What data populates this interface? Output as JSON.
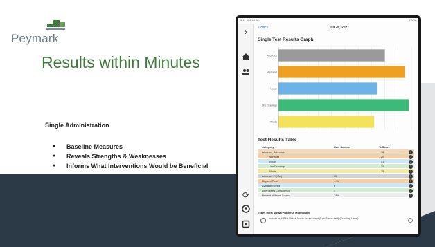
{
  "slide": {
    "logo_text": "Peymark",
    "title": "Results within Minutes",
    "subtitle": "Single Administration",
    "bullets": [
      "Baseline Measures",
      "Reveals Strengths & Weaknesses",
      "Informs What Interventions Would be Beneficial"
    ]
  },
  "colors": {
    "title_green": "#3e7a3a",
    "dark_band": "#2b3a46",
    "bar_grey": "#9a9a9a",
    "bar_orange": "#f0a020",
    "bar_blue": "#6cb4e8",
    "bar_green": "#3cba78",
    "bar_yellow": "#f2e35a",
    "link_blue": "#2a7be4"
  },
  "app": {
    "status_left": "9:41 AM Jul 26",
    "status_right": "100%",
    "back_label": "< Back",
    "date": "Jul 26, 2021",
    "graph_title": "Single Test Results Graph",
    "table_title": "Test Results Table",
    "table_headers": [
      "Category",
      "Raw Scores",
      "% Score"
    ],
    "table_rows": [
      {
        "label": "Accuracy Subtotals",
        "raw": "",
        "score": "78",
        "color": "#f3d9b5"
      },
      {
        "label": "Alphabet",
        "raw": "",
        "score": "20",
        "color": "#f6cfa6"
      },
      {
        "label": "Vocab",
        "raw": "",
        "score": "21",
        "color": "#cfe6f4"
      },
      {
        "label": "Line Drawings",
        "raw": "",
        "score": "20",
        "color": "#d4ecd2"
      },
      {
        "label": "Words",
        "raw": "",
        "score": "15",
        "color": "#f2eaa8"
      },
      {
        "label": "Accuracy (%) Adj",
        "raw": "20",
        "score": "",
        "color": "#cfd3d6"
      },
      {
        "label": "Elapsed Time",
        "raw": "4:11",
        "score": "",
        "color": "#f6cfa6"
      },
      {
        "label": "Average Speed",
        "raw": "8",
        "score": "",
        "color": "#cfe6f4"
      },
      {
        "label": "Line Speed Consistency",
        "raw": "4",
        "score": "",
        "color": "#d4ecd2"
      },
      {
        "label": "Percent of Items Correct",
        "raw": "78%",
        "score": "",
        "color": "#eeeeee"
      }
    ],
    "exam_title": "Exam Type: WRM (Progress Monitoring)",
    "exam_text": "Include in WRM* Virtual Mode Assessment (Last 6 mos test) (Tracking Level)",
    "sidebar_icons": [
      "chevron-right-icon",
      "home-icon",
      "people-icon",
      "sync-icon",
      "account-icon",
      "logout-icon"
    ]
  },
  "chart_data": {
    "type": "bar",
    "orientation": "horizontal",
    "title": "Single Test Results Graph",
    "categories": [
      "Accuracy",
      "Alphabet",
      "Vocab",
      "Line Drawings",
      "Words"
    ],
    "values": [
      80,
      95,
      74,
      98,
      72
    ],
    "xlim": [
      0,
      100
    ],
    "series_colors": [
      "#9a9a9a",
      "#f0a020",
      "#6cb4e8",
      "#3cba78",
      "#f2e35a"
    ]
  }
}
